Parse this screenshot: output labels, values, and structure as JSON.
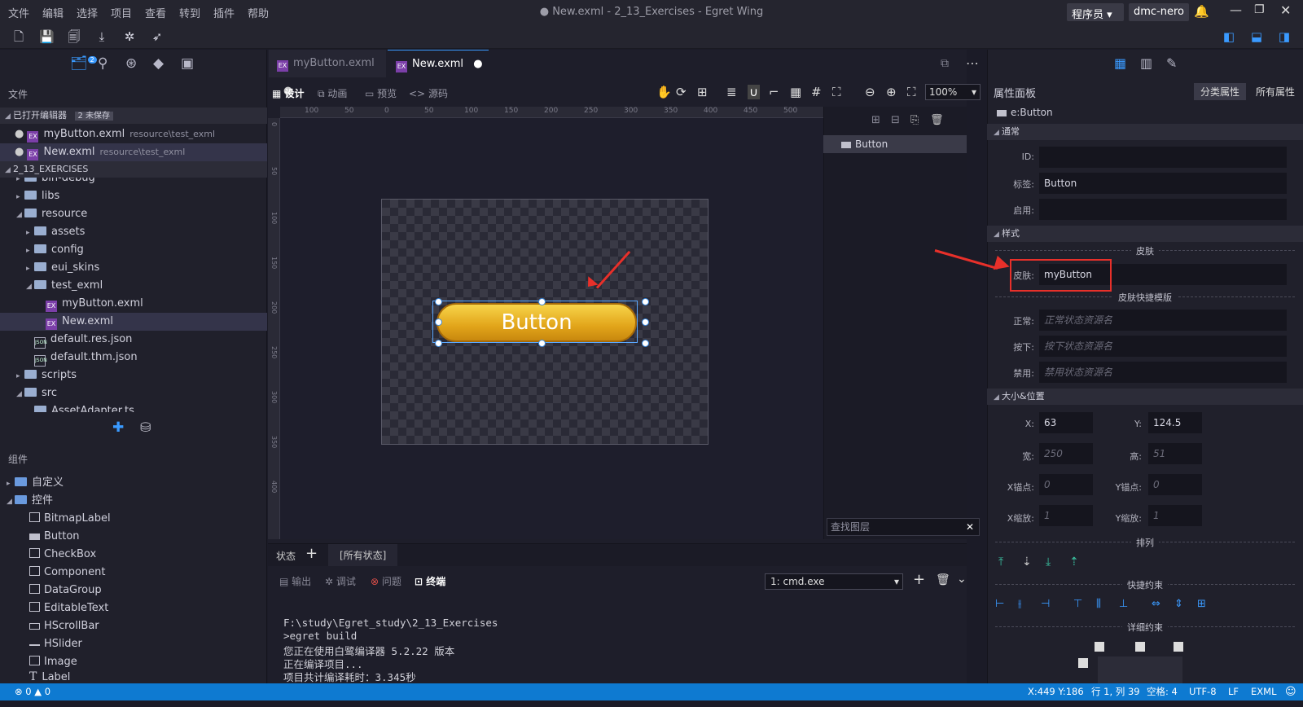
{
  "menu": [
    "文件",
    "编辑",
    "选择",
    "项目",
    "查看",
    "转到",
    "插件",
    "帮助"
  ],
  "window_title": "● New.exml - 2_13_Exercises - Egret Wing",
  "account": {
    "role": "程序员",
    "user": "dmc-nero"
  },
  "left_panel": {
    "files_title": "文件",
    "open_editors": {
      "label": "已打开编辑器",
      "badge": "2 未保存"
    },
    "open_files": [
      {
        "name": "myButton.exml",
        "path": "resource\\test_exml"
      },
      {
        "name": "New.exml",
        "path": "resource\\test_exml"
      }
    ],
    "project_label": "2_13_EXERCISES",
    "tree": [
      "bin-debug",
      "libs",
      "resource",
      "assets",
      "config",
      "eui_skins",
      "test_exml",
      "myButton.exml",
      "New.exml",
      "default.res.json",
      "default.thm.json",
      "scripts",
      "src",
      "AssetAdapter.ts"
    ],
    "components_title": "组件",
    "component_groups": [
      "自定义",
      "控件"
    ],
    "components": [
      "BitmapLabel",
      "Button",
      "CheckBox",
      "Component",
      "DataGroup",
      "EditableText",
      "HScrollBar",
      "HSlider",
      "Image",
      "Label"
    ],
    "icon_badge": "2"
  },
  "tabs": [
    "myButton.exml",
    "New.exml"
  ],
  "design_bar": {
    "design": "设计",
    "animation": "动画",
    "preview": "预览",
    "source": "源码",
    "zoom": "100%"
  },
  "ruler_top": [
    "100",
    "50",
    "0",
    "50",
    "100",
    "150",
    "200",
    "250",
    "300",
    "350",
    "400",
    "450",
    "500"
  ],
  "ruler_left": [
    "0",
    "50",
    "100",
    "150",
    "200",
    "250",
    "300",
    "350",
    "400"
  ],
  "canvas": {
    "button_label": "Button"
  },
  "layers": {
    "row": "Button",
    "search_placeholder": "查找图层"
  },
  "state_bar": {
    "label": "状态",
    "add": "+",
    "state": "[所有状态]"
  },
  "term_bar": {
    "output": "输出",
    "debug": "调试",
    "problems": "问题",
    "terminal": "终端",
    "shell": "1: cmd.exe"
  },
  "terminal_lines": [
    "F:\\study\\Egret_study\\2_13_Exercises",
    ">egret build",
    "您正在使用白鹭编译器 5.2.22 版本",
    "正在编译项目...",
    "项目共计编译耗时：3.345秒"
  ],
  "properties": {
    "title": "属性面板",
    "tab_category": "分类属性",
    "tab_all": "所有属性",
    "element": "e:Button",
    "sections": {
      "common": "通常",
      "style": "样式",
      "size": "大小&位置"
    },
    "id_label": "ID:",
    "id_value": "",
    "label_label": "标签:",
    "label_value": "Button",
    "enabled_label": "启用:",
    "enabled_value": "",
    "skin_group": "皮肤",
    "skin_label": "皮肤:",
    "skin_value": "myButton",
    "skin_quick_group": "皮肤快捷模版",
    "normal_label": "正常:",
    "normal_ph": "正常状态资源名",
    "down_label": "按下:",
    "down_ph": "按下状态资源名",
    "disabled_label": "禁用:",
    "disabled_ph": "禁用状态资源名",
    "x_label": "X:",
    "x_value": "63",
    "y_label": "Y:",
    "y_value": "124.5",
    "w_label": "宽:",
    "w_value": "250",
    "h_label": "高:",
    "h_value": "51",
    "ax_label": "X锚点:",
    "ax_value": "0",
    "ay_label": "Y锚点:",
    "ay_value": "0",
    "sx_label": "X缩放:",
    "sx_value": "1",
    "sy_label": "Y缩放:",
    "sy_value": "1",
    "arrange_group": "排列",
    "quick_constraint_group": "快捷约束",
    "detail_constraint_group": "详细约束"
  },
  "status_bar": {
    "errors": "0",
    "warnings": "0",
    "coords": "X:449 Y:186",
    "position": "行 1, 列 39",
    "spaces": "空格: 4",
    "encoding": "UTF-8",
    "eol": "LF",
    "language": "EXML"
  },
  "colors": {
    "accent": "#0e7ad1",
    "annotation": "#e8302a",
    "button_gold": "#e8b523"
  }
}
